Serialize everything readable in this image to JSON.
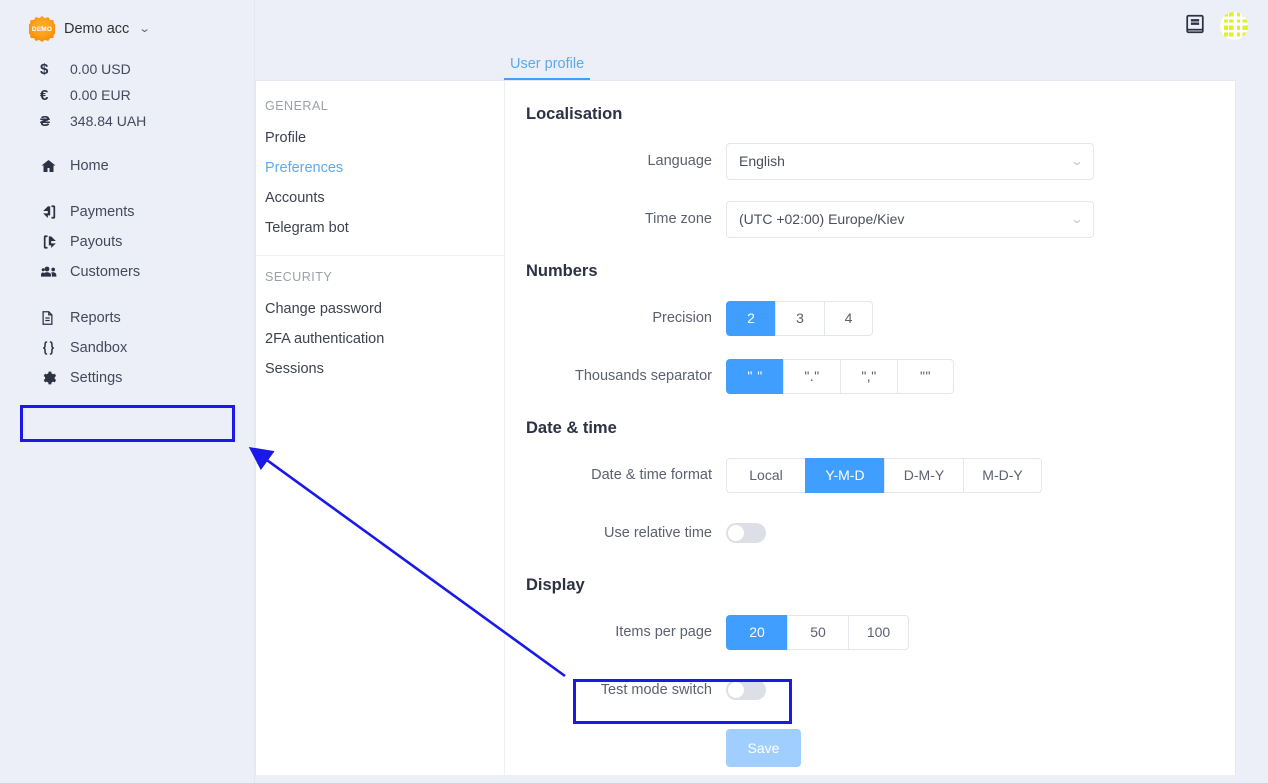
{
  "sidebar": {
    "account": {
      "name": "Demo acc",
      "badge_text": "DEMO",
      "caret": "⌄"
    },
    "balances": [
      {
        "symbol": "$",
        "value": "0.00 USD"
      },
      {
        "symbol": "€",
        "value": "0.00 EUR"
      },
      {
        "symbol": "₴",
        "value": "348.84 UAH"
      }
    ],
    "nav_groups": [
      {
        "items": [
          {
            "label": "Home",
            "icon": "home-icon"
          }
        ]
      },
      {
        "items": [
          {
            "label": "Payments",
            "icon": "sign-in-arrow-icon"
          },
          {
            "label": "Payouts",
            "icon": "sign-out-arrow-icon"
          },
          {
            "label": "Customers",
            "icon": "users-icon"
          }
        ]
      },
      {
        "items": [
          {
            "label": "Reports",
            "icon": "document-icon"
          },
          {
            "label": "Sandbox",
            "icon": "code-braces-icon"
          },
          {
            "label": "Settings",
            "icon": "gear-icon"
          }
        ]
      }
    ]
  },
  "topbar": {
    "doc_icon": "book-icon",
    "avatar_icon": "user-avatar-identicon"
  },
  "tabs": [
    {
      "label": "User profile",
      "active": true
    }
  ],
  "settings_nav": {
    "sections": [
      {
        "title": "GENERAL",
        "items": [
          {
            "label": "Profile",
            "active": false
          },
          {
            "label": "Preferences",
            "active": true
          },
          {
            "label": "Accounts",
            "active": false
          },
          {
            "label": "Telegram bot",
            "active": false
          }
        ]
      },
      {
        "title": "SECURITY",
        "items": [
          {
            "label": "Change password",
            "active": false
          },
          {
            "label": "2FA authentication",
            "active": false
          },
          {
            "label": "Sessions",
            "active": false
          }
        ]
      }
    ]
  },
  "panel": {
    "localisation": {
      "title": "Localisation",
      "language": {
        "label": "Language",
        "value": "English"
      },
      "timezone": {
        "label": "Time zone",
        "value": "(UTC +02:00) Europe/Kiev"
      }
    },
    "numbers": {
      "title": "Numbers",
      "precision": {
        "label": "Precision",
        "options": [
          "2",
          "3",
          "4"
        ],
        "selected": "2"
      },
      "thousands_separator": {
        "label": "Thousands separator",
        "options": [
          "\" \"",
          "\".\"",
          "\",\"",
          "\"\""
        ],
        "selected": "\" \""
      }
    },
    "datetime": {
      "title": "Date & time",
      "format": {
        "label": "Date & time format",
        "options": [
          "Local",
          "Y-M-D",
          "D-M-Y",
          "M-D-Y"
        ],
        "selected": "Y-M-D"
      },
      "relative_time": {
        "label": "Use relative time",
        "enabled": false
      }
    },
    "display": {
      "title": "Display",
      "items_per_page": {
        "label": "Items per page",
        "options": [
          "20",
          "50",
          "100"
        ],
        "selected": "20"
      },
      "test_mode": {
        "label": "Test mode switch",
        "enabled": false
      }
    },
    "save_label": "Save"
  },
  "annotation": {
    "highlight_color": "#1a19e8",
    "arrow_from": "test-mode-switch",
    "arrow_to": "sidebar-empty-box"
  }
}
